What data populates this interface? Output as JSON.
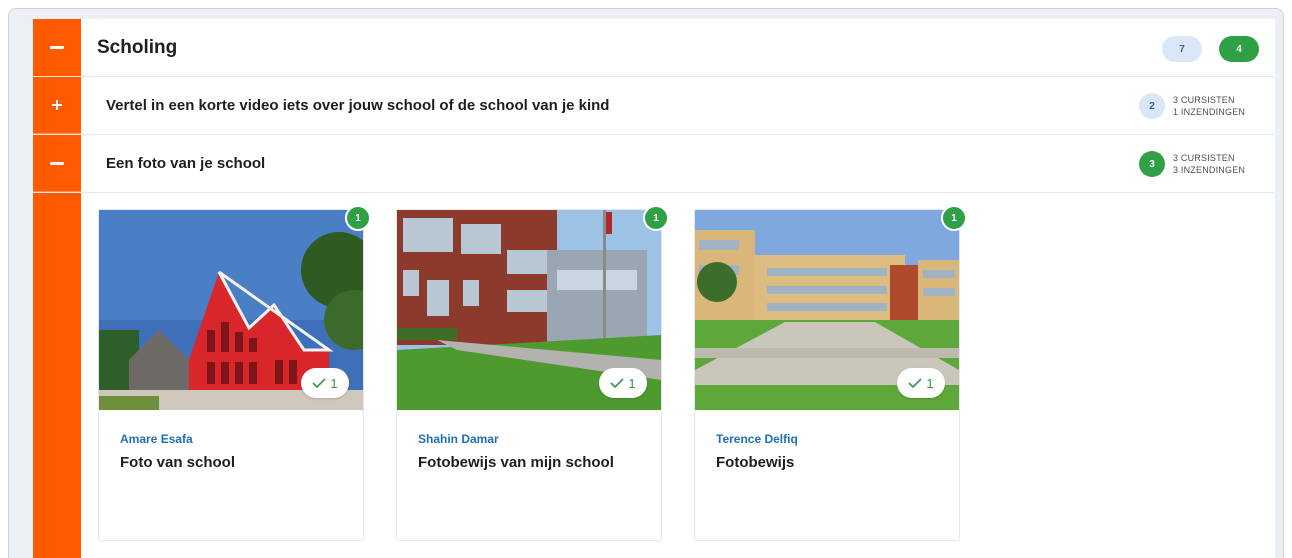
{
  "section": {
    "title": "Scholing",
    "badge_blue": "7",
    "badge_green": "4",
    "toggle_icon": "minus-icon"
  },
  "assignments": [
    {
      "label": "Vertel in een korte video iets over jouw school of de school van je kind",
      "count": "2",
      "students": "3 CURSISTEN",
      "submissions": "1 INZENDINGEN",
      "toggle_icon": "plus-icon",
      "count_color": "#dbe7f7"
    },
    {
      "label": "Een foto van je school",
      "count": "3",
      "students": "3 CURSISTEN",
      "submissions": "3 INZENDINGEN",
      "toggle_icon": "minus-icon",
      "count_color": "#2fa046"
    }
  ],
  "cards": [
    {
      "author": "Amare Esafa",
      "title": "Foto van school",
      "badge": "1",
      "likes": "1"
    },
    {
      "author": "Shahin Damar",
      "title": "Fotobewijs van mijn school",
      "badge": "1",
      "likes": "1"
    },
    {
      "author": "Terence Delfiq",
      "title": "Fotobewijs",
      "badge": "1",
      "likes": "1"
    }
  ],
  "colors": {
    "accent": "#ff5a00",
    "success": "#2fa046",
    "link": "#1f6fb8"
  }
}
